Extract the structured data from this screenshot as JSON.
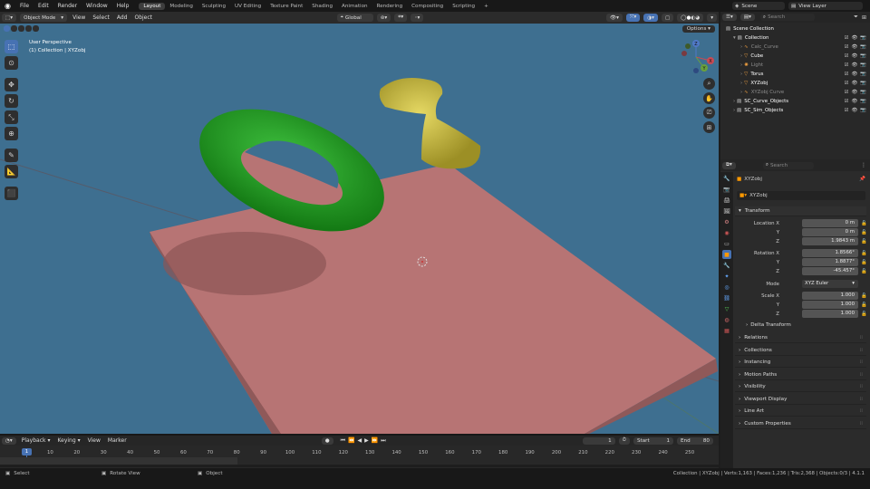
{
  "menus": [
    "File",
    "Edit",
    "Render",
    "Window",
    "Help"
  ],
  "workspaces": [
    "Layout",
    "Modeling",
    "Sculpting",
    "UV Editing",
    "Texture Paint",
    "Shading",
    "Animation",
    "Rendering",
    "Compositing",
    "Scripting"
  ],
  "workspace_add": "+",
  "scene": {
    "name": "Scene",
    "view_layer": "View Layer"
  },
  "header3d": {
    "mode": "Object Mode",
    "menus": [
      "View",
      "Select",
      "Add",
      "Object"
    ],
    "orientation": "Global"
  },
  "viewport": {
    "perspective": "User Perspective",
    "collection_label": "(1) Collection | XYZobj",
    "options": "Options",
    "gizmo": {
      "z": "Z",
      "x": "X",
      "y": "Y"
    }
  },
  "outliner": {
    "search_placeholder": "Search",
    "items": [
      {
        "name": "Scene Collection",
        "depth": 0,
        "color": "#ffffff"
      },
      {
        "name": "Collection",
        "depth": 1,
        "color": "#ffffff"
      },
      {
        "name": "Calc_Curve",
        "depth": 2,
        "color": "#8c8c8c"
      },
      {
        "name": "Cube",
        "depth": 2,
        "color": "#ffffff"
      },
      {
        "name": "Light",
        "depth": 2,
        "color": "#8c8c8c"
      },
      {
        "name": "Torus",
        "depth": 2,
        "color": "#ffffff"
      },
      {
        "name": "XYZobj",
        "depth": 2,
        "color": "#ffffff"
      },
      {
        "name": "XYZobj Curve",
        "depth": 2,
        "color": "#8c8c8c"
      },
      {
        "name": "SC_Curve_Objects",
        "depth": 1,
        "color": "#ffffff"
      },
      {
        "name": "SC_Sim_Objects",
        "depth": 1,
        "color": "#ffffff"
      }
    ]
  },
  "properties": {
    "search_placeholder": "Search",
    "object_name": "XYZobj",
    "data_name": "XYZobj",
    "transform_title": "Transform",
    "location": {
      "x_label": "Location X",
      "y_label": "Y",
      "z_label": "Z",
      "x": "0 m",
      "y": "0 m",
      "z": "1.9843 m"
    },
    "rotation": {
      "x_label": "Rotation X",
      "y_label": "Y",
      "z_label": "Z",
      "x": "1.8566°",
      "y": "1.8877°",
      "z": "-45.457°"
    },
    "mode": {
      "label": "Mode",
      "value": "XYZ Euler"
    },
    "scale": {
      "x_label": "Scale X",
      "y_label": "Y",
      "z_label": "Z",
      "x": "1.000",
      "y": "1.000",
      "z": "1.000"
    },
    "delta_transform": "Delta Transform",
    "panels": [
      "Relations",
      "Collections",
      "Instancing",
      "Motion Paths",
      "Visibility",
      "Viewport Display",
      "Line Art",
      "Custom Properties"
    ]
  },
  "timeline": {
    "menus": [
      "Playback",
      "Keying",
      "View",
      "Marker"
    ],
    "current_frame": "1",
    "start_label": "Start",
    "start": "1",
    "end_label": "End",
    "end": "80",
    "ticks": [
      "10",
      "20",
      "30",
      "40",
      "50",
      "60",
      "70",
      "80",
      "90",
      "100",
      "110",
      "120",
      "130",
      "140",
      "150",
      "160",
      "170",
      "180",
      "190",
      "200",
      "210",
      "220",
      "230",
      "240",
      "250"
    ],
    "playhead": "1"
  },
  "statusbar": {
    "select": "Select",
    "rotate": "Rotate View",
    "object": "Object",
    "stats": "Collection | XYZobj | Verts:1,163 | Faces:1,236 | Tris:2,368 | Objects:0/3 | 4.1.1"
  }
}
